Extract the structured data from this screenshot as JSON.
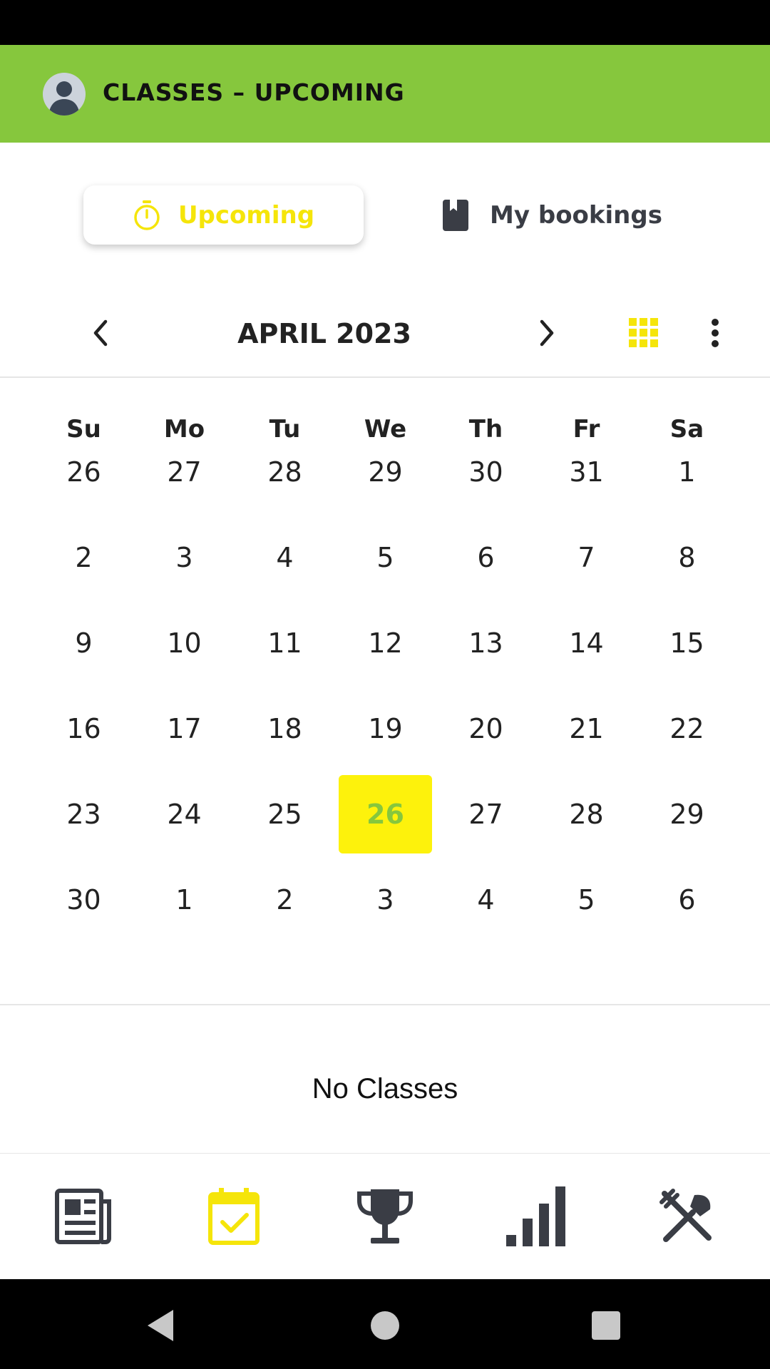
{
  "app_bar": {
    "title": "CLASSES – UPCOMING"
  },
  "tabs": {
    "upcoming_label": "Upcoming",
    "bookings_label": "My bookings",
    "active": "Upcoming"
  },
  "calendar": {
    "month_label": "APRIL 2023",
    "weekdays": [
      "Su",
      "Mo",
      "Tu",
      "We",
      "Th",
      "Fr",
      "Sa"
    ],
    "weeks": [
      [
        "26",
        "27",
        "28",
        "29",
        "30",
        "31",
        "1"
      ],
      [
        "2",
        "3",
        "4",
        "5",
        "6",
        "7",
        "8"
      ],
      [
        "9",
        "10",
        "11",
        "12",
        "13",
        "14",
        "15"
      ],
      [
        "16",
        "17",
        "18",
        "19",
        "20",
        "21",
        "22"
      ],
      [
        "23",
        "24",
        "25",
        "26",
        "27",
        "28",
        "29"
      ],
      [
        "30",
        "1",
        "2",
        "3",
        "4",
        "5",
        "6"
      ]
    ],
    "selected_day": "26",
    "selected_week": 4
  },
  "empty_message": "No Classes",
  "bottom_nav": [
    {
      "icon": "newspaper-icon",
      "active": false
    },
    {
      "icon": "calendar-check-icon",
      "active": true
    },
    {
      "icon": "trophy-icon",
      "active": false
    },
    {
      "icon": "bar-chart-icon",
      "active": false
    },
    {
      "icon": "utensils-icon",
      "active": false
    }
  ],
  "colors": {
    "brand_green": "#86c73d",
    "accent_yellow": "#f5e50a",
    "selected_bg": "#fdf20c",
    "icon_dark": "#3a3d45"
  }
}
